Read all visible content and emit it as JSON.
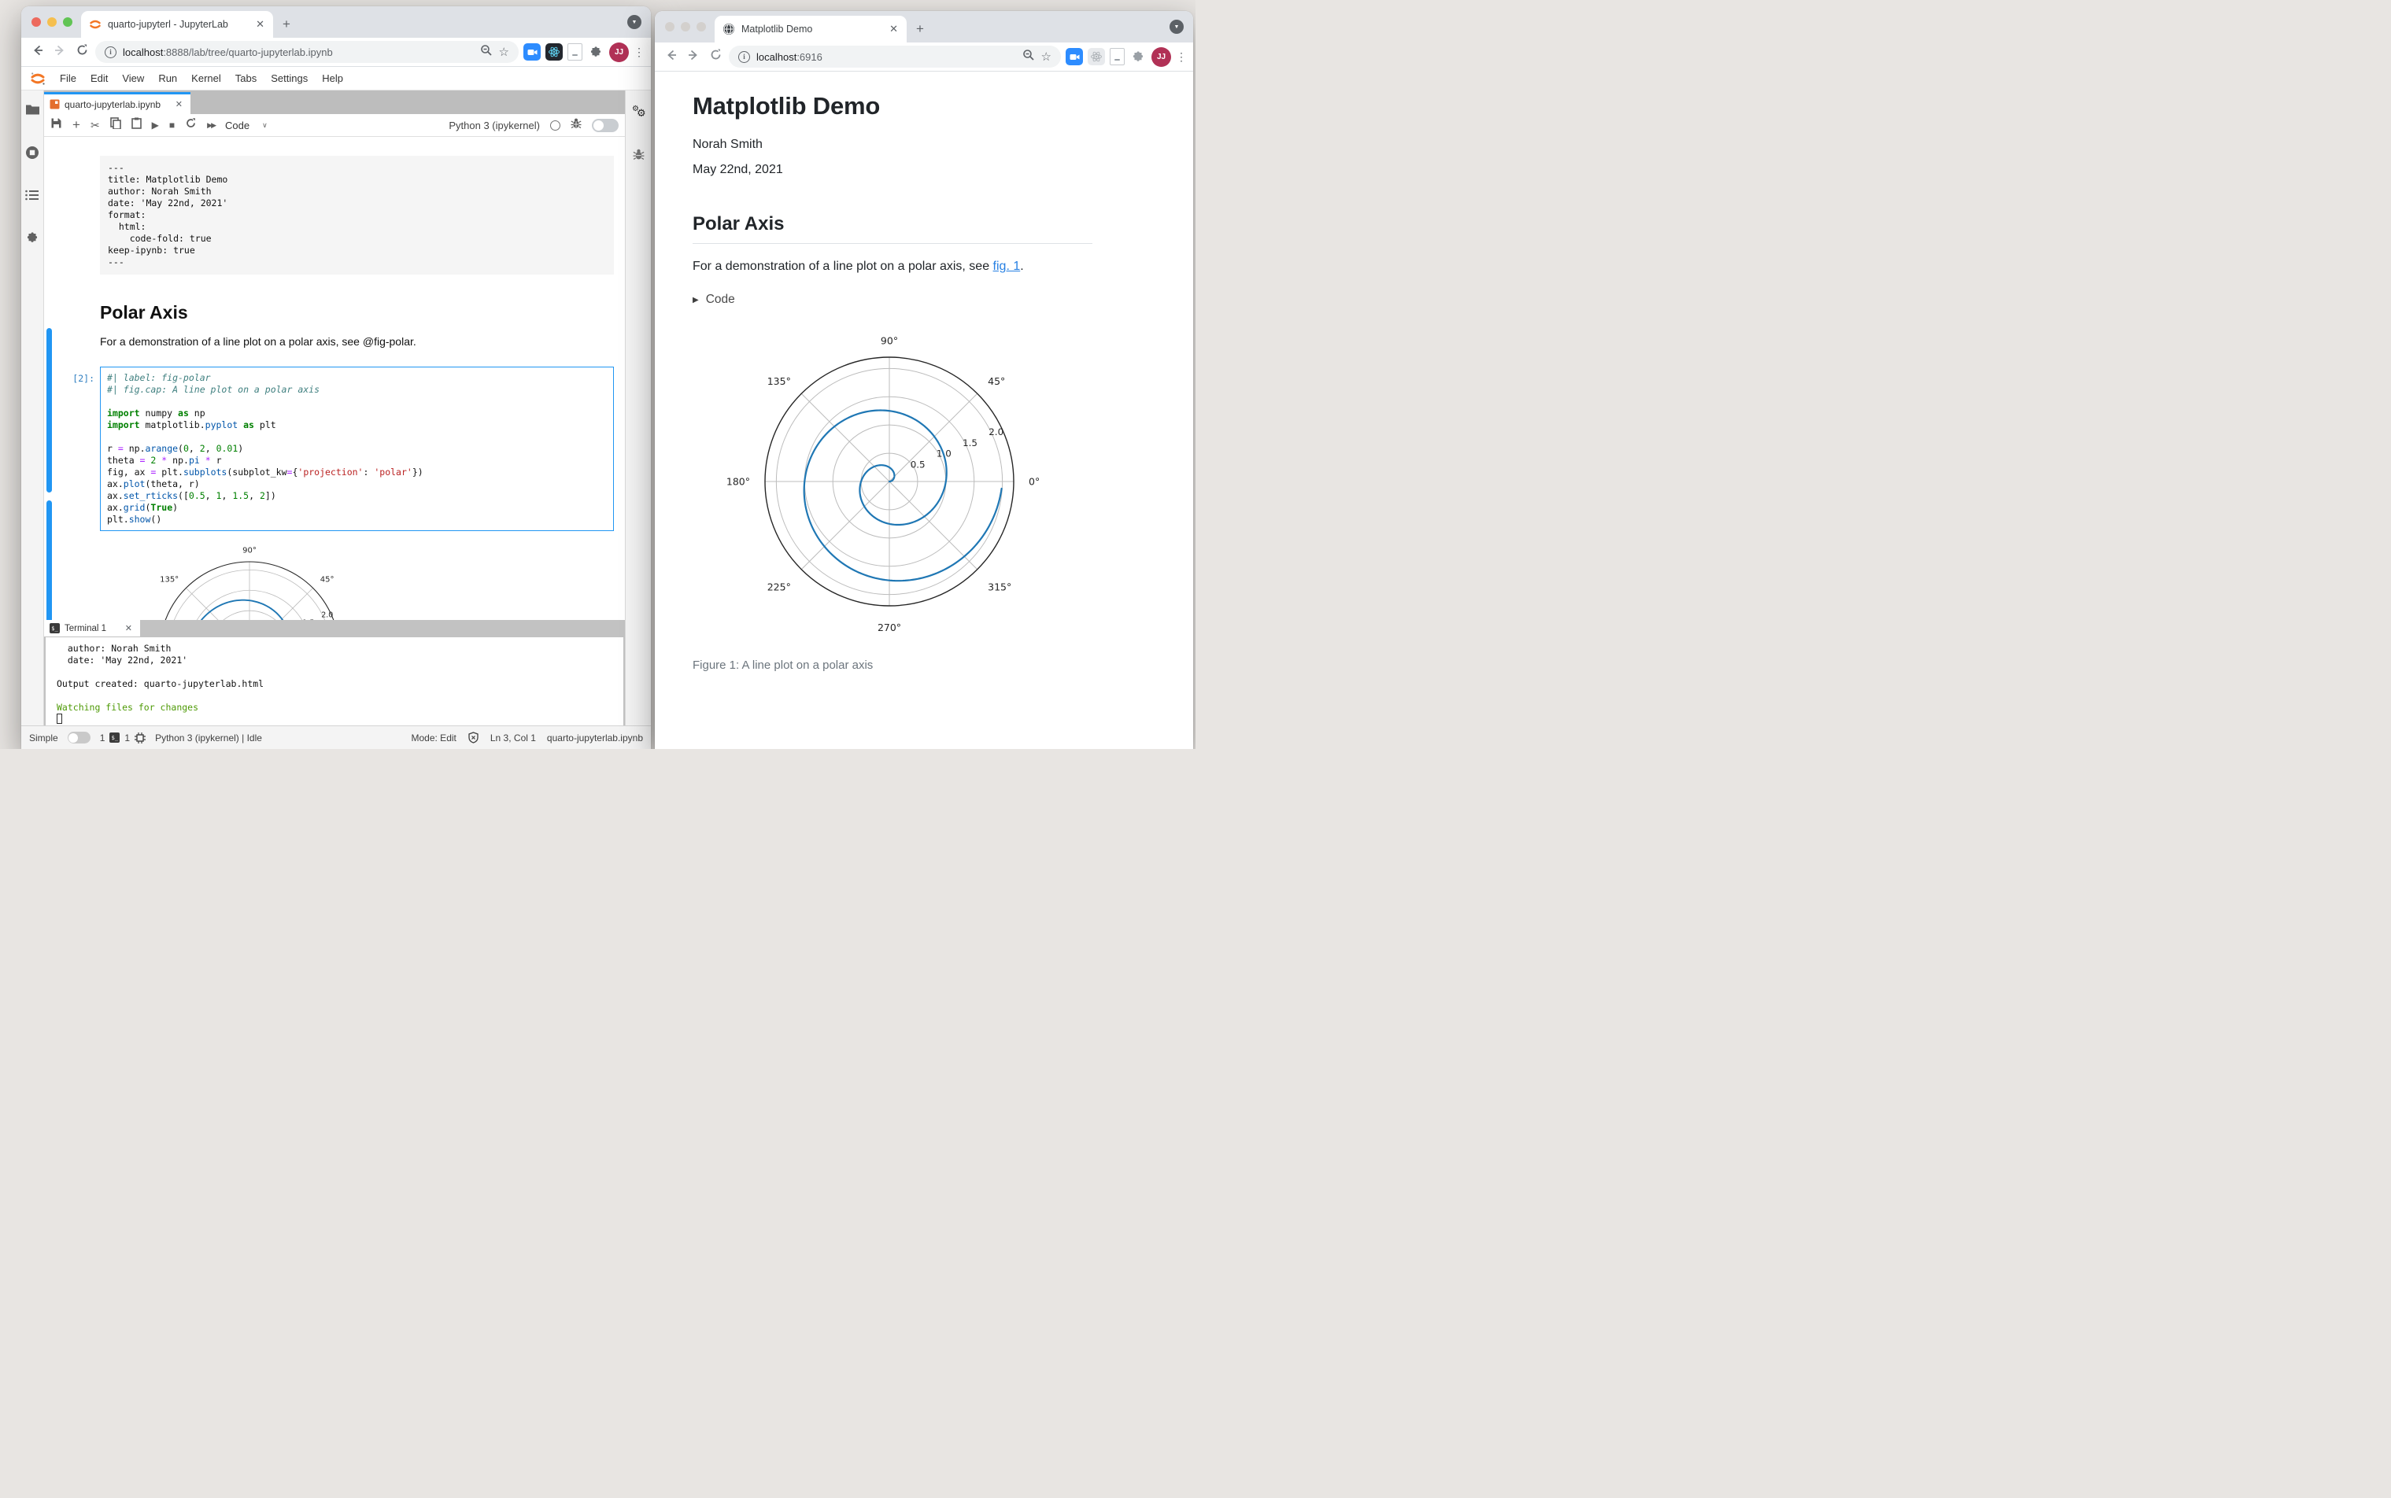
{
  "colors": {
    "accent_blue": "#2196f3",
    "matplotlib_line": "#1f77b4",
    "link_blue": "#2780e3",
    "terminal_green": "#4e9a06",
    "prompt_blue": "#307fc1"
  },
  "left_window": {
    "browser": {
      "tab_title": "quarto-jupyterl - JupyterLab",
      "url_host": "localhost",
      "url_rest": ":8888/lab/tree/quarto-jupyterlab.ipynb",
      "avatar_initials": "JJ"
    },
    "menubar": [
      "File",
      "Edit",
      "View",
      "Run",
      "Kernel",
      "Tabs",
      "Settings",
      "Help"
    ],
    "notebook": {
      "tab_label": "quarto-jupyterlab.ipynb",
      "cell_type": "Code",
      "kernel_name": "Python 3 (ipykernel)",
      "raw_cell_text": "---\ntitle: Matplotlib Demo\nauthor: Norah Smith\ndate: 'May 22nd, 2021'\nformat:\n  html:\n    code-fold: true\nkeep-ipynb: true\n---",
      "heading": "Polar Axis",
      "paragraph": "For a demonstration of a line plot on a polar axis, see @fig-polar.",
      "execution_prompt": "[2]:",
      "code_lines": [
        [
          {
            "t": "#| label: fig-polar",
            "c": "com"
          }
        ],
        [
          {
            "t": "#| fig.cap: A line plot on a polar axis",
            "c": "com"
          }
        ],
        [],
        [
          {
            "t": "import",
            "c": "kw"
          },
          {
            "t": " numpy "
          },
          {
            "t": "as",
            "c": "kw"
          },
          {
            "t": " np"
          }
        ],
        [
          {
            "t": "import",
            "c": "kw"
          },
          {
            "t": " matplotlib."
          },
          {
            "t": "pyplot",
            "c": "prop"
          },
          {
            "t": " "
          },
          {
            "t": "as",
            "c": "kw"
          },
          {
            "t": " plt"
          }
        ],
        [],
        [
          {
            "t": "r "
          },
          {
            "t": "=",
            "c": "op"
          },
          {
            "t": " np."
          },
          {
            "t": "arange",
            "c": "prop"
          },
          {
            "t": "("
          },
          {
            "t": "0",
            "c": "num"
          },
          {
            "t": ", "
          },
          {
            "t": "2",
            "c": "num"
          },
          {
            "t": ", "
          },
          {
            "t": "0.01",
            "c": "num"
          },
          {
            "t": ")"
          }
        ],
        [
          {
            "t": "theta "
          },
          {
            "t": "=",
            "c": "op"
          },
          {
            "t": " "
          },
          {
            "t": "2",
            "c": "num"
          },
          {
            "t": " "
          },
          {
            "t": "*",
            "c": "op"
          },
          {
            "t": " np."
          },
          {
            "t": "pi",
            "c": "prop"
          },
          {
            "t": " "
          },
          {
            "t": "*",
            "c": "op"
          },
          {
            "t": " r"
          }
        ],
        [
          {
            "t": "fig, ax "
          },
          {
            "t": "=",
            "c": "op"
          },
          {
            "t": " plt."
          },
          {
            "t": "subplots",
            "c": "prop"
          },
          {
            "t": "(subplot_kw"
          },
          {
            "t": "=",
            "c": "op"
          },
          {
            "t": "{"
          },
          {
            "t": "'projection'",
            "c": "str"
          },
          {
            "t": ": "
          },
          {
            "t": "'polar'",
            "c": "str"
          },
          {
            "t": "})"
          }
        ],
        [
          {
            "t": "ax."
          },
          {
            "t": "plot",
            "c": "prop"
          },
          {
            "t": "(theta, r)"
          }
        ],
        [
          {
            "t": "ax."
          },
          {
            "t": "set_rticks",
            "c": "prop"
          },
          {
            "t": "(["
          },
          {
            "t": "0.5",
            "c": "num"
          },
          {
            "t": ", "
          },
          {
            "t": "1",
            "c": "num"
          },
          {
            "t": ", "
          },
          {
            "t": "1.5",
            "c": "num"
          },
          {
            "t": ", "
          },
          {
            "t": "2",
            "c": "num"
          },
          {
            "t": "])"
          }
        ],
        [
          {
            "t": "ax."
          },
          {
            "t": "grid",
            "c": "prop"
          },
          {
            "t": "("
          },
          {
            "t": "True",
            "c": "kw"
          },
          {
            "t": ")"
          }
        ],
        [
          {
            "t": "plt."
          },
          {
            "t": "show",
            "c": "prop"
          },
          {
            "t": "()"
          }
        ]
      ]
    },
    "terminal": {
      "tab_label": "Terminal 1",
      "lines": [
        [
          {
            "t": "  author: Norah Smith"
          }
        ],
        [
          {
            "t": "  date: 'May 22nd, 2021'"
          }
        ],
        [],
        [
          {
            "t": "Output created: quarto-jupyterlab.html"
          }
        ],
        [],
        [
          {
            "t": "Watching files for changes",
            "c": "green"
          }
        ],
        [
          {
            "t": "",
            "c": "cursor"
          }
        ]
      ]
    },
    "statusbar": {
      "simple_label": "Simple",
      "terminals_count": "1",
      "kernels_count": "1",
      "kernel_status": "Python 3 (ipykernel) | Idle",
      "mode": "Mode: Edit",
      "cursor_position": "Ln 3, Col 1",
      "filename": "quarto-jupyterlab.ipynb"
    }
  },
  "right_window": {
    "browser": {
      "tab_title": "Matplotlib Demo",
      "url_host": "localhost",
      "url_rest": ":6916",
      "avatar_initials": "JJ"
    },
    "doc": {
      "title": "Matplotlib Demo",
      "author": "Norah Smith",
      "date": "May 22nd, 2021",
      "heading": "Polar Axis",
      "paragraph_before_link": "For a demonstration of a line plot on a polar axis, see ",
      "link_text": "fig. 1",
      "paragraph_after_link": ".",
      "code_fold_label": "Code",
      "figure_caption": "Figure 1: A line plot on a polar axis"
    }
  },
  "chart_data": {
    "type": "line",
    "projection": "polar",
    "description": "Archimedean spiral r = theta/(2*pi); r from 0 to 2 (step 0.01), theta = 2*pi*r, two full revolutions",
    "r_start": 0,
    "r_end": 2,
    "r_step": 0.01,
    "theta_ticks_deg": [
      0,
      45,
      90,
      135,
      180,
      225,
      270,
      315
    ],
    "theta_labels": [
      "0°",
      "45°",
      "90°",
      "135°",
      "180°",
      "225°",
      "270°",
      "315°"
    ],
    "r_ticks": [
      0.5,
      1.0,
      1.5,
      2.0
    ],
    "r_tick_labels": [
      "0.5",
      "1.0",
      "1.5",
      "2.0"
    ],
    "r_label_angle_deg": 22.5,
    "r_max_display": 2.2,
    "grid": true,
    "line_color": "#1f77b4"
  }
}
